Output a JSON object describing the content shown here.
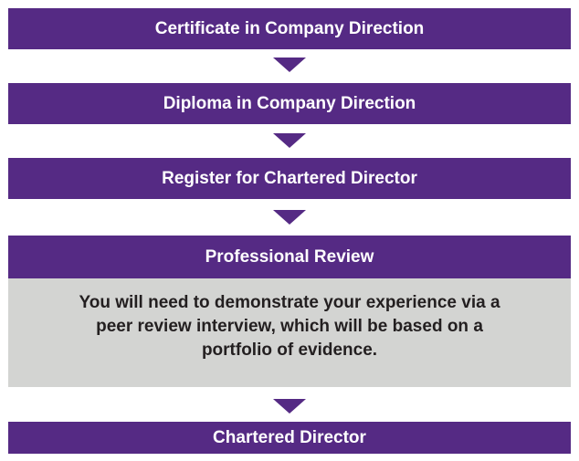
{
  "colors": {
    "primary": "#552a84",
    "note_background": "#d3d4d2",
    "text_on_primary": "#ffffff",
    "note_text": "#231f20"
  },
  "steps": [
    {
      "label": "Certificate in Company Direction"
    },
    {
      "label": "Diploma in Company Direction"
    },
    {
      "label": "Register for Chartered Director"
    },
    {
      "label": "Professional Review",
      "note": "You will need to demonstrate your experience via a peer review interview, which will be based on a portfolio of evidence."
    },
    {
      "label": "Chartered Director"
    }
  ]
}
